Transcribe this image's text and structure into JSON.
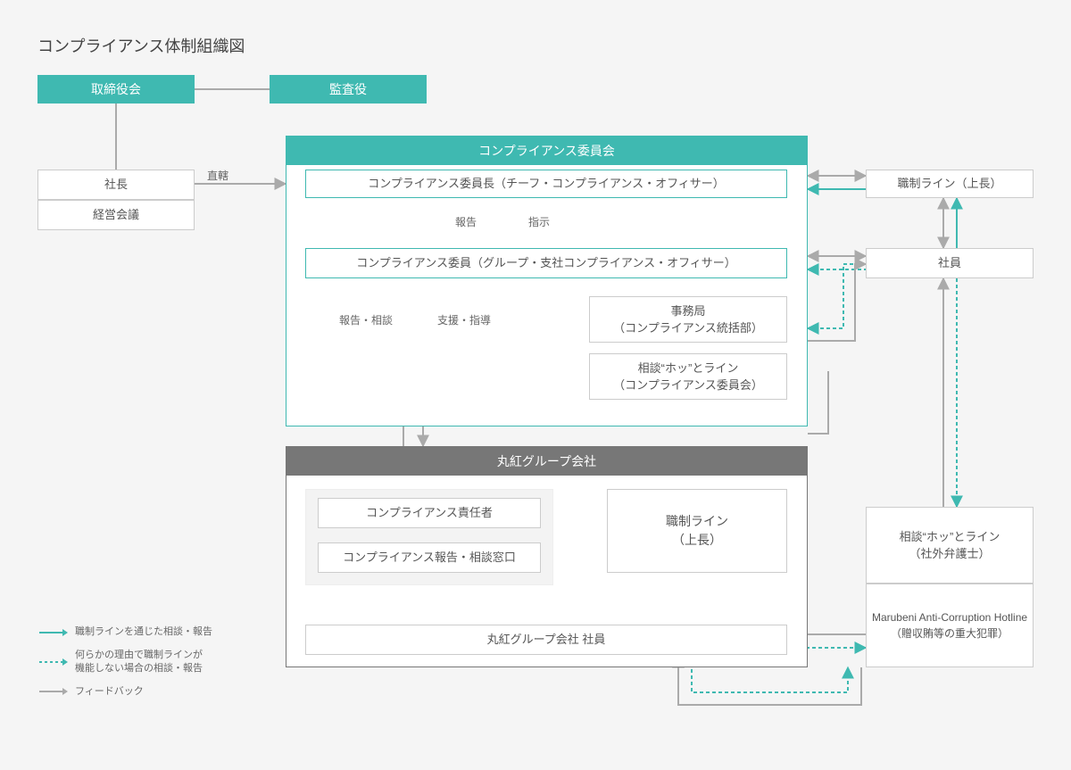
{
  "title": "コンプライアンス体制組織図",
  "colors": {
    "teal": "#3fb9b1",
    "gray_arrow": "#aaaaaa",
    "gray_fill": "#777777"
  },
  "top": {
    "board": "取締役会",
    "auditor": "監査役"
  },
  "left": {
    "president": "社長",
    "mgmt_meeting": "経営会議",
    "direct": "直轄"
  },
  "committee": {
    "header": "コンプライアンス委員会",
    "chair": "コンプライアンス委員長（チーフ・コンプライアンス・オフィサー）",
    "member": "コンプライアンス委員（グループ・支社コンプライアンス・オフィサー）",
    "report": "報告",
    "instruct": "指示",
    "report_consult": "報告・相談",
    "support": "支援・指導",
    "secretariat": "事務局\n（コンプライアンス統括部）",
    "hotline": "相談“ホッ”とライン\n（コンプライアンス委員会）"
  },
  "group": {
    "header": "丸紅グループ会社",
    "officer": "コンプライアンス責任者",
    "desk": "コンプライアンス報告・相談窓口",
    "line": "職制ライン\n（上長）",
    "employee": "丸紅グループ会社 社員"
  },
  "right": {
    "superior": "職制ライン（上長）",
    "employee": "社員",
    "hotline_ext": "相談“ホッ”とライン\n（社外弁護士）",
    "anticorruption": "Marubeni Anti-Corruption Hotline\n（贈収賄等の重大犯罪）"
  },
  "legend": {
    "solid": "職制ラインを通じた相談・報告",
    "dashed": "何らかの理由で職制ラインが\n機能しない場合の相談・報告",
    "feedback": "フィードバック"
  }
}
